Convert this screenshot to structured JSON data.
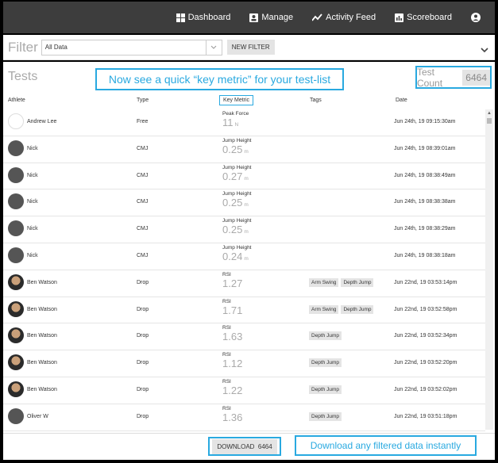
{
  "nav": {
    "items": [
      {
        "label": "Dashboard",
        "icon": "dashboard-icon"
      },
      {
        "label": "Manage",
        "icon": "manage-icon"
      },
      {
        "label": "Activity Feed",
        "icon": "activity-feed-icon"
      },
      {
        "label": "Scoreboard",
        "icon": "scoreboard-icon"
      }
    ],
    "account_icon": "user-circle-icon"
  },
  "filter": {
    "label": "Filter",
    "selected": "All Data",
    "new_filter_label": "NEW FILTER"
  },
  "tests": {
    "title": "Tests",
    "callout": "Now see a quick “key metric” for your test-list",
    "count_label": "Test Count",
    "count": "6464",
    "columns": {
      "athlete": "Athlete",
      "type": "Type",
      "key_metric": "Key Metric",
      "tags": "Tags",
      "date": "Date"
    },
    "rows": [
      {
        "athlete": "Andrew Lee",
        "avatar": "logo",
        "type": "Free",
        "metric_label": "Peak Force",
        "metric_value": "11",
        "metric_unit": "N",
        "tags": [],
        "date": "Jun 24th, 19 09:15:30am"
      },
      {
        "athlete": "Nick",
        "avatar": "photo",
        "type": "CMJ",
        "metric_label": "Jump Height",
        "metric_value": "0.25",
        "metric_unit": "m",
        "tags": [],
        "date": "Jun 24th, 19 08:39:01am"
      },
      {
        "athlete": "Nick",
        "avatar": "photo",
        "type": "CMJ",
        "metric_label": "Jump Height",
        "metric_value": "0.27",
        "metric_unit": "m",
        "tags": [],
        "date": "Jun 24th, 19 08:38:49am"
      },
      {
        "athlete": "Nick",
        "avatar": "photo",
        "type": "CMJ",
        "metric_label": "Jump Height",
        "metric_value": "0.25",
        "metric_unit": "m",
        "tags": [],
        "date": "Jun 24th, 19 08:38:38am"
      },
      {
        "athlete": "Nick",
        "avatar": "photo",
        "type": "CMJ",
        "metric_label": "Jump Height",
        "metric_value": "0.25",
        "metric_unit": "m",
        "tags": [],
        "date": "Jun 24th, 19 08:38:29am"
      },
      {
        "athlete": "Nick",
        "avatar": "photo",
        "type": "CMJ",
        "metric_label": "Jump Height",
        "metric_value": "0.24",
        "metric_unit": "m",
        "tags": [],
        "date": "Jun 24th, 19 08:38:18am"
      },
      {
        "athlete": "Ben Watson",
        "avatar": "face",
        "type": "Drop",
        "metric_label": "RSI",
        "metric_value": "1.27",
        "metric_unit": "",
        "tags": [
          "Arm Swing",
          "Depth Jump"
        ],
        "date": "Jun 22nd, 19 03:53:14pm"
      },
      {
        "athlete": "Ben Watson",
        "avatar": "face",
        "type": "Drop",
        "metric_label": "RSI",
        "metric_value": "1.71",
        "metric_unit": "",
        "tags": [
          "Arm Swing",
          "Depth Jump"
        ],
        "date": "Jun 22nd, 19 03:52:58pm"
      },
      {
        "athlete": "Ben Watson",
        "avatar": "face",
        "type": "Drop",
        "metric_label": "RSI",
        "metric_value": "1.63",
        "metric_unit": "",
        "tags": [
          "Depth Jump"
        ],
        "date": "Jun 22nd, 19 03:52:34pm"
      },
      {
        "athlete": "Ben Watson",
        "avatar": "face",
        "type": "Drop",
        "metric_label": "RSI",
        "metric_value": "1.12",
        "metric_unit": "",
        "tags": [
          "Depth Jump"
        ],
        "date": "Jun 22nd, 19 03:52:20pm"
      },
      {
        "athlete": "Ben Watson",
        "avatar": "face",
        "type": "Drop",
        "metric_label": "RSI",
        "metric_value": "1.22",
        "metric_unit": "",
        "tags": [
          "Depth Jump"
        ],
        "date": "Jun 22nd, 19 03:52:02pm"
      },
      {
        "athlete": "Oliver W",
        "avatar": "photo",
        "type": "Drop",
        "metric_label": "RSI",
        "metric_value": "1.36",
        "metric_unit": "",
        "tags": [
          "Depth Jump"
        ],
        "date": "Jun 22nd, 19 03:51:18pm"
      }
    ]
  },
  "bottom": {
    "download_label": "DOWNLOAD",
    "download_count": "6464",
    "callout": "Download any filtered data instantly"
  },
  "colors": {
    "accent": "#29a9e0",
    "nav_bg": "#3d3d3d"
  }
}
